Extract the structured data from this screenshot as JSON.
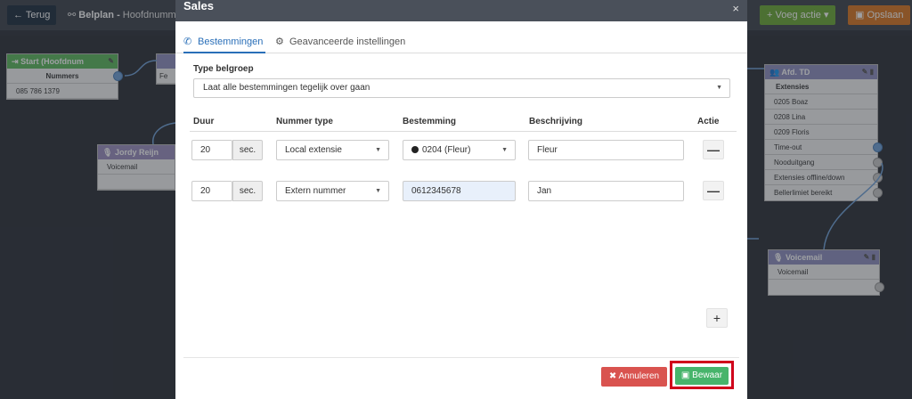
{
  "topbar": {
    "back_label": "Terug",
    "breadcrumb_bold": "Belplan -",
    "breadcrumb_rest": " Hoofdnumme",
    "add_action_label": "Voeg actie",
    "save_label": "Opslaan"
  },
  "nodes": {
    "start": {
      "title": "Start (Hoofdnum",
      "sub": "Nummers",
      "rows": [
        "085 786 1379"
      ]
    },
    "jordy": {
      "title": "Jordy Reijn",
      "rows": [
        "Voicemail",
        ""
      ]
    },
    "td": {
      "title": "Afd. TD",
      "sub": "Extensies",
      "rows": [
        "0205 Boaz",
        "0208 Lina",
        "0209 Floris",
        "Time-out",
        "Nooduitgang",
        "Extensies offline/down",
        "Bellerlimiet bereikt"
      ]
    },
    "voicemail": {
      "title": "Voicemail",
      "rows": [
        "Voicemail",
        ""
      ]
    },
    "partial": {
      "row": "Fe"
    }
  },
  "modal": {
    "title": "Sales",
    "close": "×",
    "tabs": [
      "Bestemmingen",
      "Geavanceerde instellingen"
    ],
    "group_label": "Type belgroep",
    "group_value": "Laat alle bestemmingen tegelijk over gaan",
    "columns": [
      "Duur",
      "Nummer type",
      "Bestemming",
      "Beschrijving",
      "Actie"
    ],
    "rows": [
      {
        "duration": "20",
        "unit": "sec.",
        "type": "Local extensie",
        "destination": "0204 (Fleur)",
        "description": "Fleur"
      },
      {
        "duration": "20",
        "unit": "sec.",
        "type": "Extern nummer",
        "destination": "0612345678",
        "description": "Jan"
      }
    ],
    "minus": "—",
    "plus": "+",
    "cancel_label": "Annuleren",
    "save_label": "Bewaar"
  },
  "colors": {
    "accent": "#2a6fb8",
    "start_header": "#5cb85c",
    "jordy_header": "#9b8fbf",
    "td_header": "#8f8fbf",
    "cancel": "#d9534f",
    "save": "#47b46b",
    "highlight": "#d0021b"
  }
}
